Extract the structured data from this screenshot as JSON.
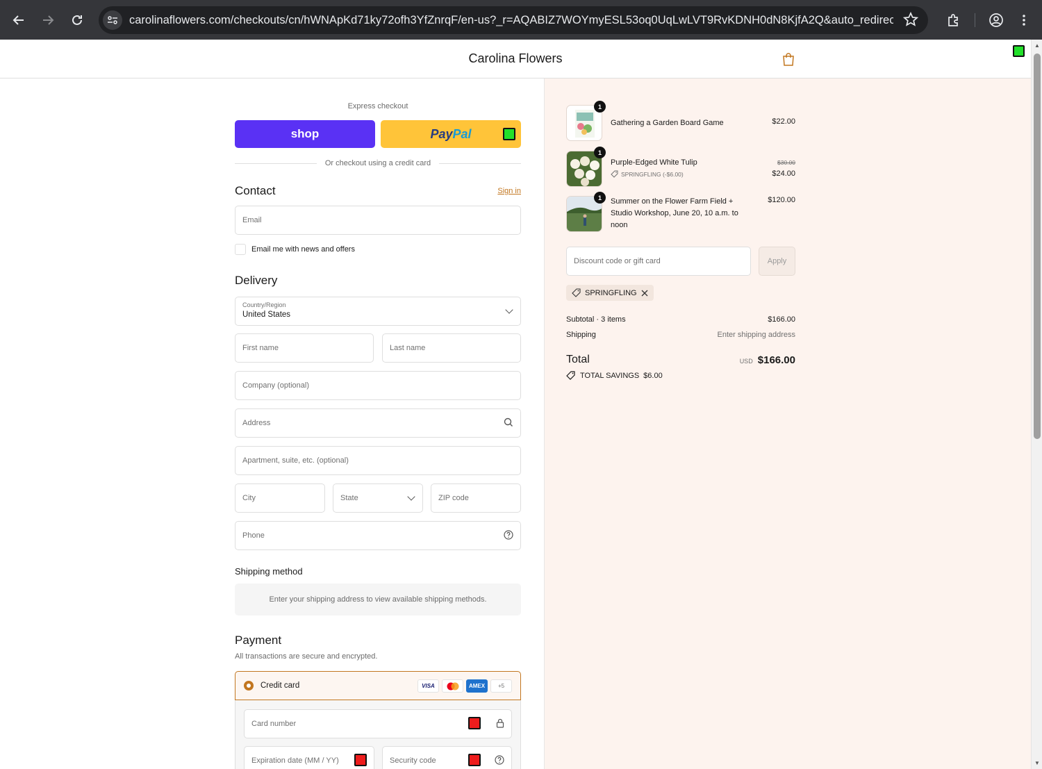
{
  "browser": {
    "url": "carolinaflowers.com/checkouts/cn/hWNApKd71ky72ofh3YfZnrqF/en-us?_r=AQABIZ7WOYmyESL53oq0UqLwLVT9RvKDNH0dN8KjfA2Q&auto_redirect=..."
  },
  "header": {
    "store_name": "Carolina Flowers"
  },
  "express": {
    "label": "Express checkout",
    "shop_label": "shop",
    "paypal_label_1": "Pay",
    "paypal_label_2": "Pal",
    "or_text": "Or checkout using a credit card"
  },
  "contact": {
    "title": "Contact",
    "sign_in": "Sign in",
    "email_placeholder": "Email",
    "news_label": "Email me with news and offers"
  },
  "delivery": {
    "title": "Delivery",
    "country_label": "Country/Region",
    "country_value": "United States",
    "first_name": "First name",
    "last_name": "Last name",
    "company": "Company (optional)",
    "address": "Address",
    "apartment": "Apartment, suite, etc. (optional)",
    "city": "City",
    "state": "State",
    "zip": "ZIP code",
    "phone": "Phone"
  },
  "shipping": {
    "title": "Shipping method",
    "message": "Enter your shipping address to view available shipping methods."
  },
  "payment": {
    "title": "Payment",
    "subtitle": "All transactions are secure and encrypted.",
    "credit_card_label": "Credit card",
    "logos": [
      "VISA",
      "",
      "AMEX",
      "+5"
    ],
    "card_number": "Card number",
    "expiration": "Expiration date (MM / YY)",
    "security_code": "Security code"
  },
  "summary": {
    "items": [
      {
        "qty": "1",
        "name": "Gathering a Garden Board Game",
        "price": "$22.00"
      },
      {
        "qty": "1",
        "name": "Purple-Edged White Tulip",
        "original_price": "$30.00",
        "price": "$24.00",
        "discount": "SPRINGFLING (-$6.00)"
      },
      {
        "qty": "1",
        "name": "Summer on the Flower Farm Field + Studio Workshop, June 20, 10 a.m. to noon",
        "price": "$120.00"
      }
    ],
    "discount_placeholder": "Discount code or gift card",
    "apply_label": "Apply",
    "applied_code": "SPRINGFLING",
    "subtotal_label": "Subtotal · 3 items",
    "subtotal_value": "$166.00",
    "shipping_label": "Shipping",
    "shipping_value": "Enter shipping address",
    "total_label": "Total",
    "currency": "USD",
    "total_value": "$166.00",
    "savings_label": "TOTAL SAVINGS",
    "savings_value": "$6.00"
  },
  "colors": {
    "accent": "#c2761f",
    "shop_purple": "#5a31f4",
    "paypal_yellow": "#ffc439",
    "summary_bg": "#fdf3ee"
  }
}
